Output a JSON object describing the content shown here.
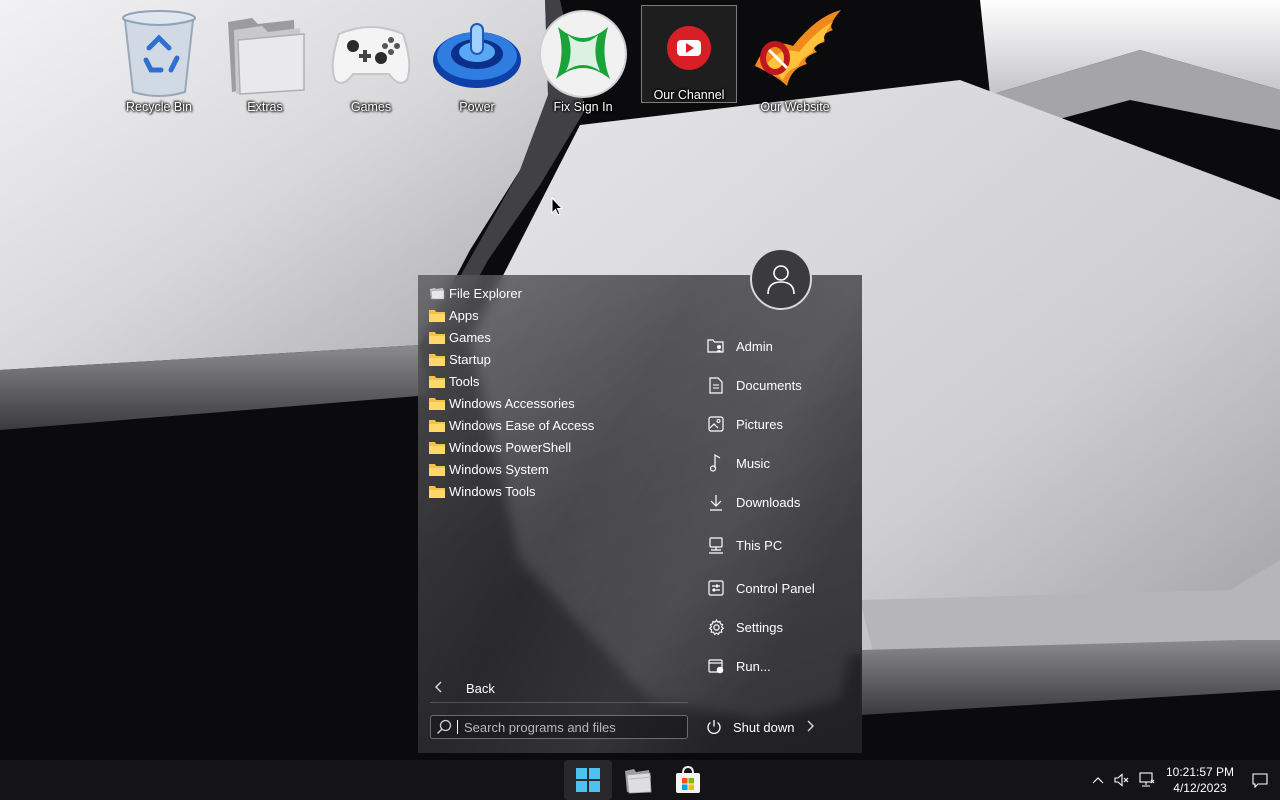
{
  "desktop": {
    "icons": [
      {
        "label": "Recycle Bin",
        "icon": "recycle-bin-icon"
      },
      {
        "label": "Extras",
        "icon": "folder-icon"
      },
      {
        "label": "Games",
        "icon": "gamepad-icon"
      },
      {
        "label": "Power",
        "icon": "power-icon"
      },
      {
        "label": "Fix Sign In",
        "icon": "xbox-icon"
      },
      {
        "label": "Our Channel",
        "icon": "youtube-icon"
      },
      {
        "label": "Our Website",
        "icon": "phoenix-logo-icon"
      }
    ]
  },
  "start_menu": {
    "programs": [
      {
        "label": "File Explorer",
        "icon": "file-explorer-icon"
      },
      {
        "label": "Apps",
        "icon": "folder-icon"
      },
      {
        "label": "Games",
        "icon": "folder-icon"
      },
      {
        "label": "Startup",
        "icon": "folder-icon"
      },
      {
        "label": "Tools",
        "icon": "folder-icon"
      },
      {
        "label": "Windows Accessories",
        "icon": "folder-icon"
      },
      {
        "label": "Windows Ease of Access",
        "icon": "folder-icon"
      },
      {
        "label": "Windows PowerShell",
        "icon": "folder-icon"
      },
      {
        "label": "Windows System",
        "icon": "folder-icon"
      },
      {
        "label": "Windows Tools",
        "icon": "folder-icon"
      }
    ],
    "back_label": "Back",
    "search_placeholder": "Search programs and files",
    "places": [
      {
        "label": "Admin",
        "icon": "user-folder-icon"
      },
      {
        "label": "Documents",
        "icon": "document-icon"
      },
      {
        "label": "Pictures",
        "icon": "picture-icon"
      },
      {
        "label": "Music",
        "icon": "music-icon"
      },
      {
        "label": "Downloads",
        "icon": "download-icon"
      },
      {
        "label": "This PC",
        "icon": "computer-icon"
      },
      {
        "label": "Control Panel",
        "icon": "control-panel-icon"
      },
      {
        "label": "Settings",
        "icon": "gear-icon"
      },
      {
        "label": "Run...",
        "icon": "run-icon"
      }
    ],
    "shutdown_label": "Shut down"
  },
  "taskbar": {
    "buttons": [
      {
        "name": "start",
        "icon": "windows-logo-icon"
      },
      {
        "name": "file-explorer",
        "icon": "file-explorer-icon"
      },
      {
        "name": "microsoft-store",
        "icon": "store-icon"
      }
    ],
    "time": "10:21:57 PM",
    "date": "4/12/2023"
  },
  "colors": {
    "folder": "#f5c24c",
    "windows_blue": "#4cc2f1",
    "taskbar_bg": "#141416"
  }
}
